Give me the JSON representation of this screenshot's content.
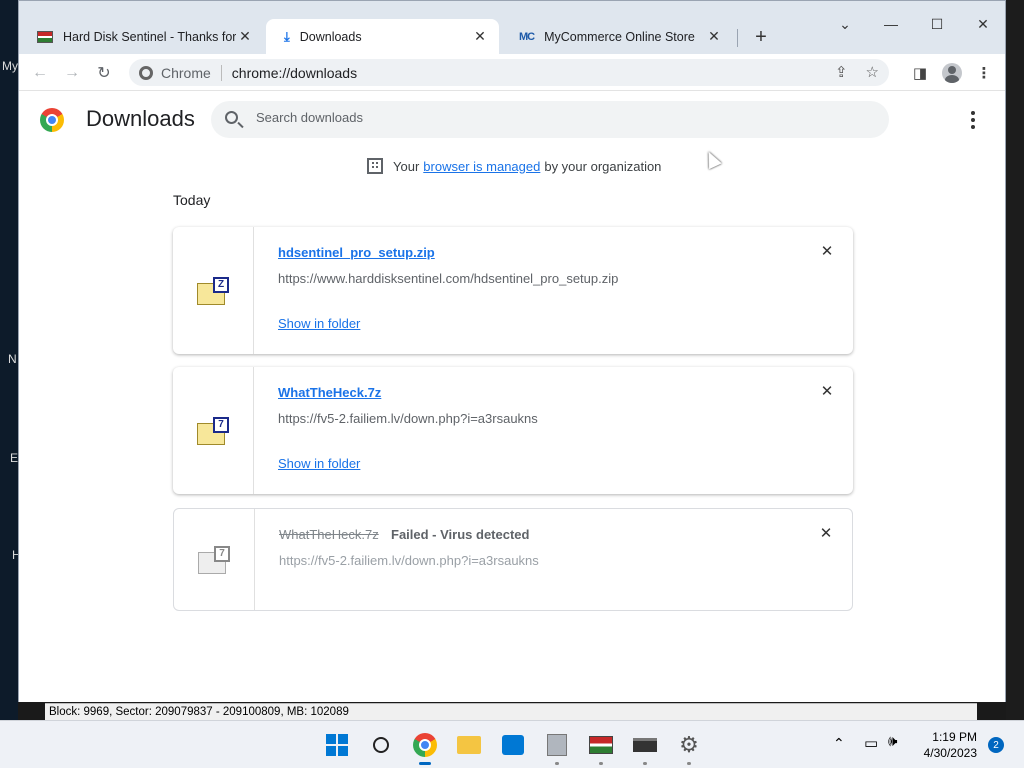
{
  "desktop": {
    "left_fragments": [
      "My",
      "N",
      "E",
      "H"
    ]
  },
  "window": {
    "tabs": [
      {
        "title": "Hard Disk Sentinel - Thanks for c",
        "icon": "hdsentinel-icon",
        "active": false
      },
      {
        "title": "Downloads",
        "icon": "download-icon",
        "active": true
      },
      {
        "title": "MyCommerce Online Store",
        "icon": "mycommerce-icon",
        "active": false
      }
    ],
    "mc_favicon_text": "MC",
    "controls": {
      "dropdown": "⌄",
      "minimize": "—",
      "maximize": "☐",
      "close": "✕"
    }
  },
  "toolbar": {
    "chip_label": "Chrome",
    "url": "chrome://downloads"
  },
  "page": {
    "title": "Downloads",
    "search_placeholder": "Search downloads",
    "managed": {
      "prefix": "Your",
      "link": "browser is managed",
      "suffix": "by your organization"
    },
    "section_label": "Today",
    "downloads": [
      {
        "file_name": "hdsentinel_pro_setup.zip",
        "url": "https://www.harddisksentinel.com/hdsentinel_pro_setup.zip",
        "action": "Show in folder",
        "badge": "Z",
        "status": ""
      },
      {
        "file_name": "WhatTheHeck.7z",
        "url": "https://fv5-2.failiem.lv/down.php?i=a3rsaukns",
        "action": "Show in folder",
        "badge": "7",
        "status": ""
      },
      {
        "file_name": "WhatTheHeck.7z",
        "url": "https://fv5-2.failiem.lv/down.php?i=a3rsaukns",
        "action": "",
        "badge": "7",
        "status": "Failed - Virus detected"
      }
    ]
  },
  "statusbar": {
    "text": "Block: 9969, Sector: 209079837 - 209100809, MB: 102089"
  },
  "taskbar": {
    "time": "1:19 PM",
    "date": "4/30/2023",
    "notification_count": "2"
  },
  "colors": {
    "accent": "#1a73e8",
    "tabstrip": "#dfe6ee",
    "taskbar": "#eef1f6"
  }
}
